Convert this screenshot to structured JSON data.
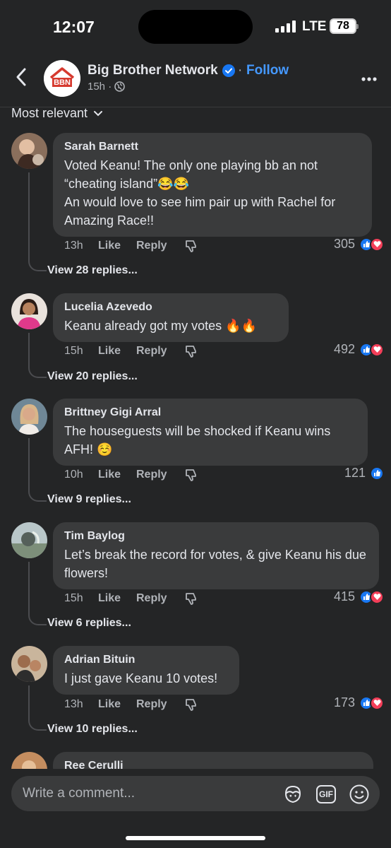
{
  "status": {
    "time": "12:07",
    "network": "LTE",
    "battery": "78"
  },
  "header": {
    "page_name": "Big Brother Network",
    "follow_label": "Follow",
    "separator": "·",
    "post_age": "15h ·",
    "logo_text": "BBN"
  },
  "sort": {
    "label": "Most relevant"
  },
  "comments": [
    {
      "author": "Sarah Barnett",
      "text": "Voted Keanu! The only one playing bb an not “cheating island”😂😂\nAn would love to see him pair up with Rachel for Amazing Race!!",
      "time": "13h",
      "like": "Like",
      "reply": "Reply",
      "reactions": "305",
      "reaction_types": [
        "like",
        "love"
      ],
      "view_replies": "View 28 replies..."
    },
    {
      "author": "Lucelia Azevedo",
      "text": "Keanu already got my votes 🔥🔥",
      "time": "15h",
      "like": "Like",
      "reply": "Reply",
      "reactions": "492",
      "reaction_types": [
        "like",
        "love"
      ],
      "view_replies": "View 20 replies..."
    },
    {
      "author": "Brittney Gigi Arral",
      "text": "The houseguests will be shocked if Keanu wins AFH! ☺️",
      "time": "10h",
      "like": "Like",
      "reply": "Reply",
      "reactions": "121",
      "reaction_types": [
        "like"
      ],
      "view_replies": "View 9 replies..."
    },
    {
      "author": "Tim Baylog",
      "text": "Let’s break the record for votes, & give Keanu his due flowers!",
      "time": "15h",
      "like": "Like",
      "reply": "Reply",
      "reactions": "415",
      "reaction_types": [
        "like",
        "love"
      ],
      "view_replies": "View 6 replies..."
    },
    {
      "author": "Adrian Bituin",
      "text": "I just gave Keanu 10 votes!",
      "time": "13h",
      "like": "Like",
      "reply": "Reply",
      "reactions": "173",
      "reaction_types": [
        "like",
        "love"
      ],
      "view_replies": "View 10 replies..."
    },
    {
      "author": "Ree Cerulli"
    }
  ],
  "composer": {
    "placeholder": "Write a comment...",
    "gif_label": "GIF"
  },
  "colors": {
    "background": "#242526",
    "bubble": "#3a3b3c",
    "accent": "#4599ff",
    "like": "#1877f2",
    "love": "#f33e58"
  }
}
